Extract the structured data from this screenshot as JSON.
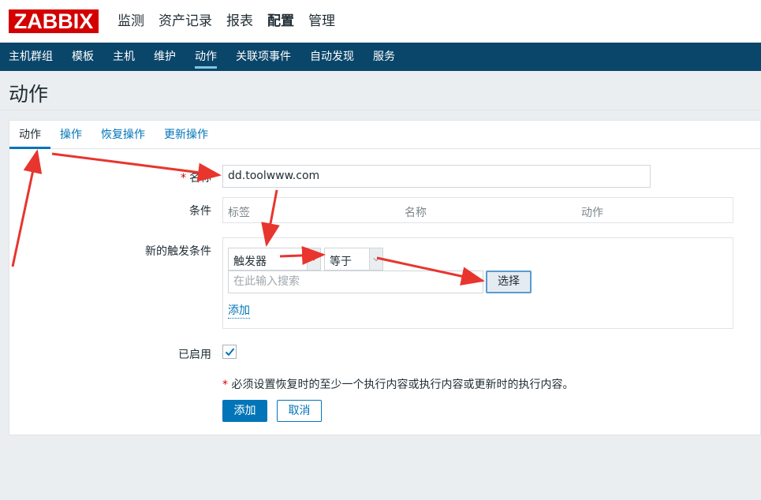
{
  "logo": "ZABBIX",
  "top_menu": [
    {
      "label": "监测"
    },
    {
      "label": "资产记录"
    },
    {
      "label": "报表"
    },
    {
      "label": "配置"
    },
    {
      "label": "管理"
    }
  ],
  "sub_menu": [
    {
      "label": "主机群组"
    },
    {
      "label": "模板"
    },
    {
      "label": "主机"
    },
    {
      "label": "维护"
    },
    {
      "label": "动作"
    },
    {
      "label": "关联项事件"
    },
    {
      "label": "自动发现"
    },
    {
      "label": "服务"
    }
  ],
  "page_title": "动作",
  "tabs": [
    {
      "label": "动作"
    },
    {
      "label": "操作"
    },
    {
      "label": "恢复操作"
    },
    {
      "label": "更新操作"
    }
  ],
  "form": {
    "name_required_mark": "*",
    "name_label": "名称",
    "name_value": "dd.toolwww.com",
    "conditions_label": "条件",
    "conditions_columns": [
      "标签",
      "名称",
      "动作"
    ],
    "new_condition_label": "新的触发条件",
    "condition_type_value": "触发器",
    "operator_value": "等于",
    "search_placeholder": "在此输入搜索",
    "choose_button": "选择",
    "add_link": "添加",
    "enabled_label": "已启用",
    "enabled_checked": true,
    "note_star": "*",
    "note_text": "必须设置恢复时的至少一个执行内容或执行内容或更新时的执行内容。",
    "add_button": "添加",
    "cancel_button": "取消"
  },
  "colors": {
    "brand": "#d40000",
    "nav_bg": "#0a466a",
    "accent": "#0275b8",
    "annotation_arrow": "#e8352e"
  }
}
